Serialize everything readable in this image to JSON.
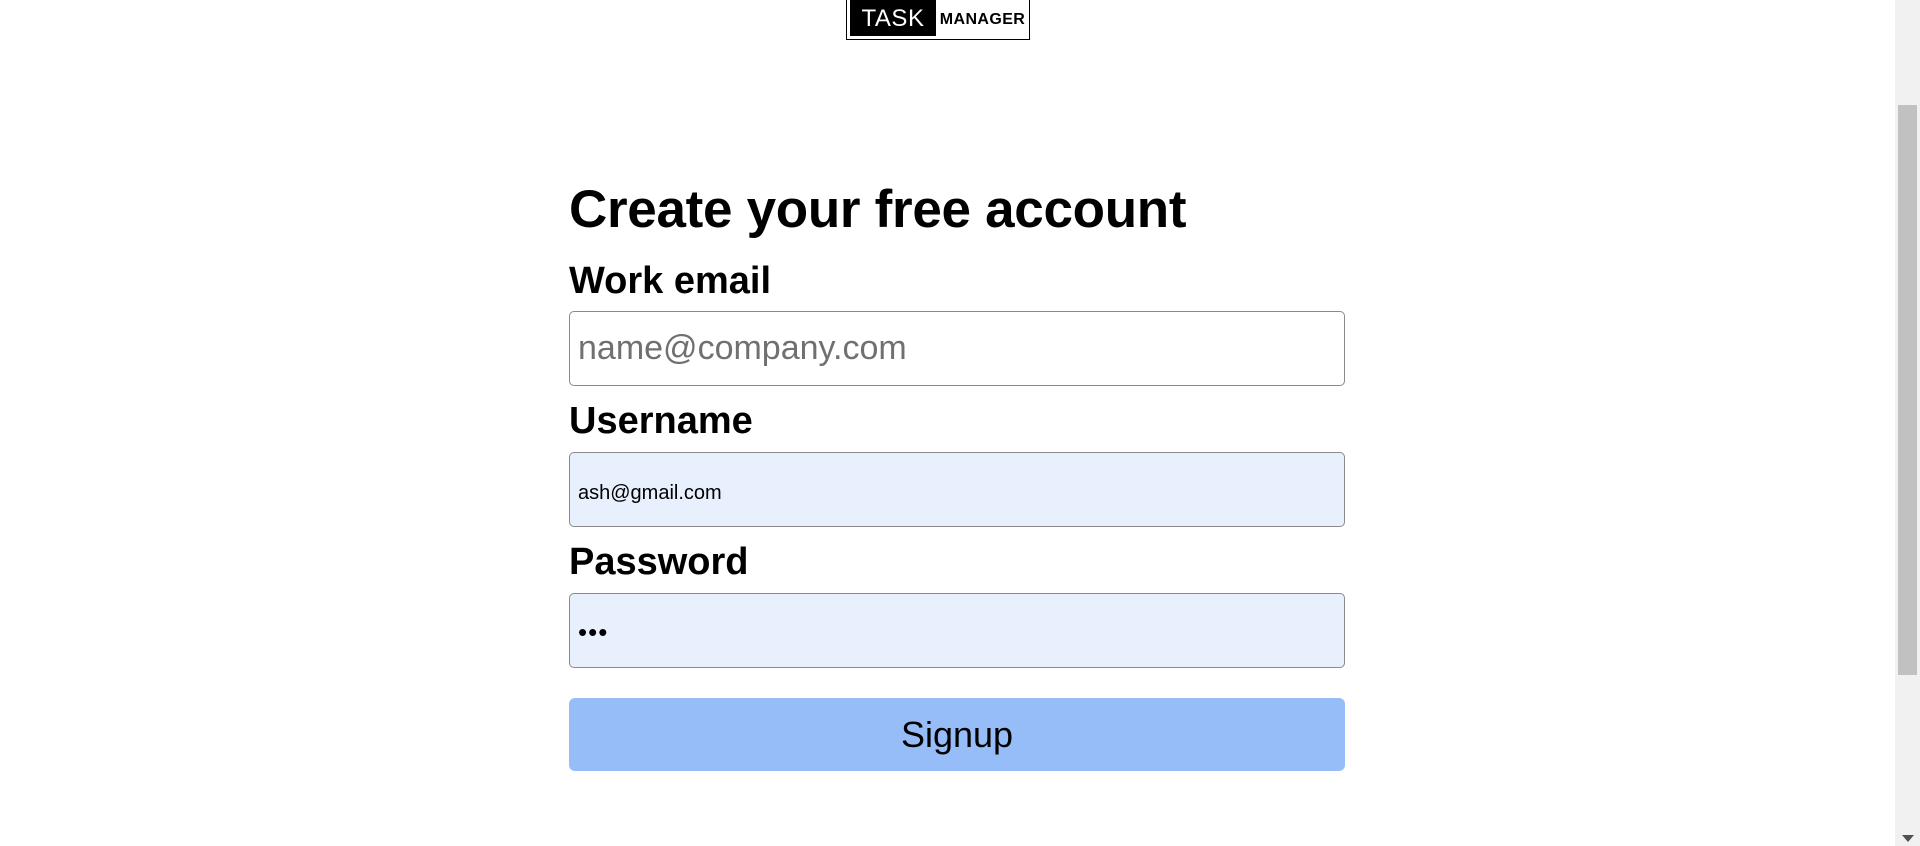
{
  "logo": {
    "part1": "TASK",
    "part2": "MANAGER"
  },
  "form": {
    "title": "Create your free account",
    "email": {
      "label": "Work email",
      "placeholder": "name@company.com",
      "value": ""
    },
    "username": {
      "label": "Username",
      "value": "ash@gmail.com"
    },
    "password": {
      "label": "Password",
      "masked_value": "•••"
    },
    "submit_label": "Signup"
  },
  "colors": {
    "button_bg": "#96bdf8",
    "autofill_bg": "#e8f0fe"
  }
}
